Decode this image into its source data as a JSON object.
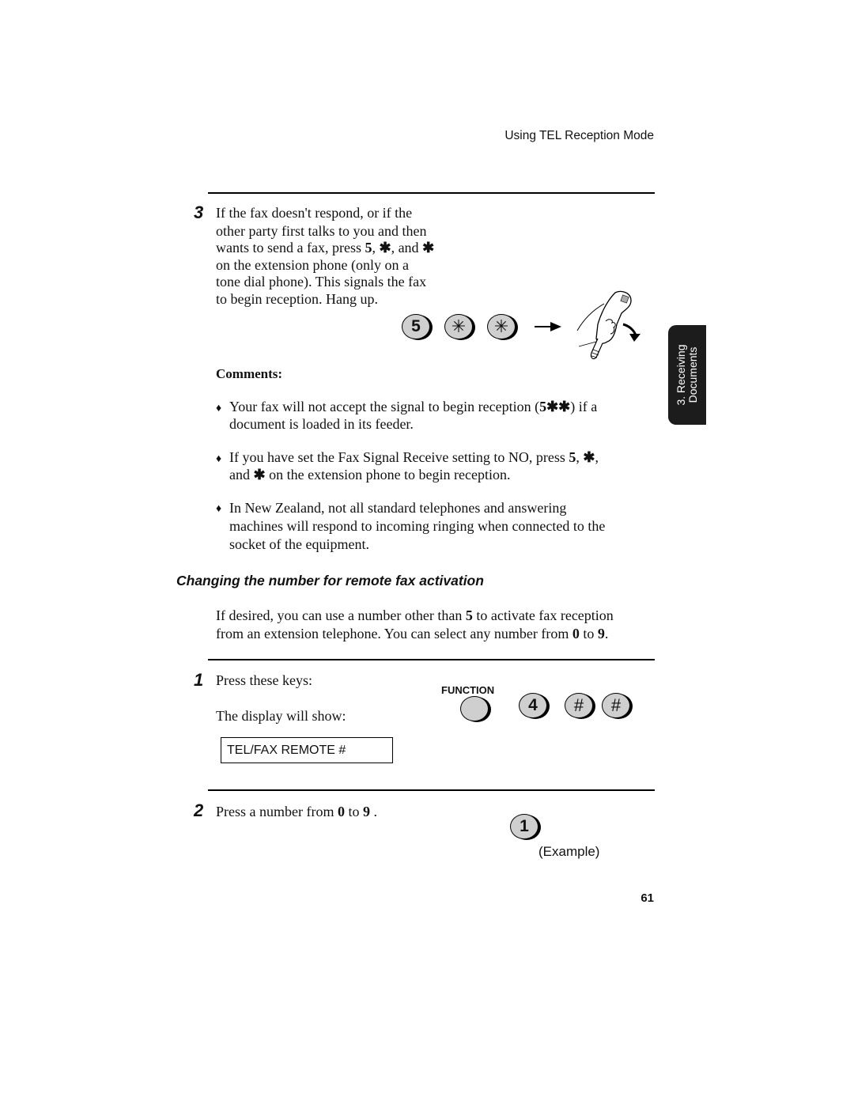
{
  "header": {
    "running_title": "Using TEL Reception Mode"
  },
  "side_tab": {
    "line1": "3. Receiving",
    "line2": "Documents",
    "background": "#1c1c1c"
  },
  "step3": {
    "number": "3",
    "lines": [
      "If the fax doesn't respond, or if the",
      "other party first talks to you and then",
      "on the extension phone (only on a",
      "tone dial phone). This signals the fax",
      "to begin reception. Hang up."
    ],
    "line3_prefix": "wants to send a fax, press ",
    "line3_bold1": "5",
    "line3_sep1": ", ",
    "line3_star1": "✱",
    "line3_sep2": ", and ",
    "line3_star2": "✱",
    "keys": [
      {
        "label": "5",
        "icon": "key-5"
      },
      {
        "label": "✳",
        "icon": "star-key"
      },
      {
        "label": "✳",
        "icon": "star-key"
      }
    ],
    "illustration": "hand-hanging-up-handset-icon"
  },
  "comments": {
    "title": "Comments:",
    "bullet_glyph": "♦",
    "items": [
      {
        "before": "Your fax will not accept the signal to begin reception (",
        "bold": "5✱✱",
        "after": ") if a",
        "line2": "document is loaded in its feeder."
      },
      {
        "before": "If you have set the Fax Signal Receive setting to NO, press ",
        "bold": "5",
        "mid": ", ",
        "star": "✱",
        "after": ",",
        "line2_pre": "and ",
        "line2_star": "✱",
        "line2_post": " on the extension phone to begin reception."
      },
      {
        "lines": [
          "In New Zealand, not all standard telephones and answering",
          "machines will respond to incoming ringing when connected to the",
          "socket of the equipment."
        ]
      }
    ]
  },
  "section": {
    "heading": "Changing the number for remote fax activation",
    "intro_l1_pre": "If desired, you can use a number other than ",
    "intro_l1_bold": "5",
    "intro_l1_post": " to activate fax reception",
    "intro_l2_pre": "from an extension telephone. You can select any number from ",
    "intro_l2_b1": "0",
    "intro_l2_mid": " to ",
    "intro_l2_b2": "9",
    "intro_l2_post": "."
  },
  "step1": {
    "number": "1",
    "press_label": "Press these keys:",
    "display_label": "The display will show:",
    "display_text": "TEL/FAX REMOTE #",
    "function_label": "FUNCTION",
    "keys": [
      {
        "label": "",
        "icon": "function-key"
      },
      {
        "label": "4",
        "icon": "key-4"
      },
      {
        "label": "#",
        "icon": "hash-key"
      },
      {
        "label": "#",
        "icon": "hash-key"
      }
    ]
  },
  "step2": {
    "number": "2",
    "text_pre": "Press a number from ",
    "b1": "0",
    "mid": " to ",
    "b2": "9",
    "post": " .",
    "example_key": "1",
    "example_label": "(Example)"
  },
  "footer": {
    "page_number": "61"
  }
}
